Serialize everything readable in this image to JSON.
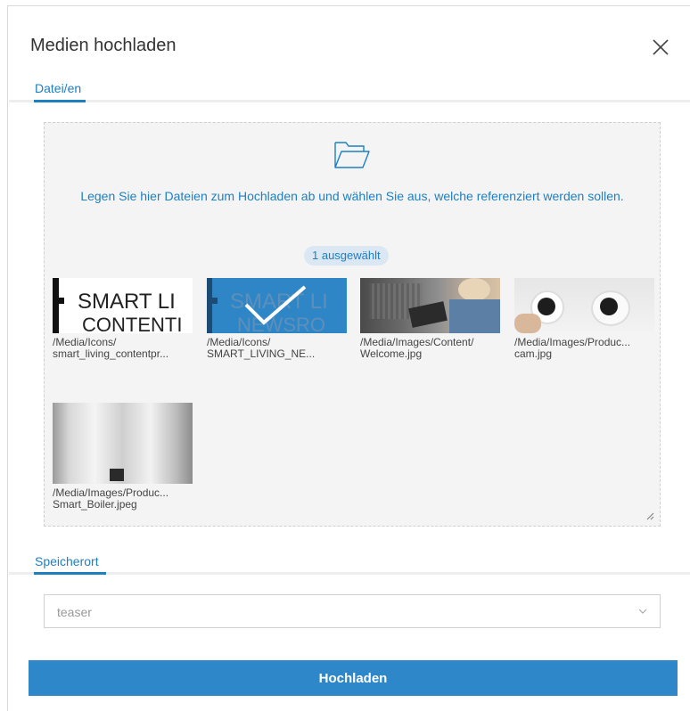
{
  "dialog": {
    "title": "Medien hochladen"
  },
  "tabs": {
    "files_label": "Datei/en",
    "location_label": "Speicherort"
  },
  "dropzone": {
    "hint": "Legen Sie hier Dateien zum Hochladen ab und wählen Sie aus, welche referenziert werden sollen.",
    "selected_badge": "1 ausgewählt",
    "items": [
      {
        "path": "/Media/Icons/",
        "file": "smart_living_contentpr...",
        "selected": false,
        "logo_lines": [
          "SMART LI",
          "CONTENTI"
        ]
      },
      {
        "path": "/Media/Icons/",
        "file": "SMART_LIVING_NE...",
        "selected": true,
        "logo_lines": [
          "SMART LI",
          "NEWSRO"
        ]
      },
      {
        "path": "/Media/Images/Content/",
        "file": "Welcome.jpg",
        "selected": false
      },
      {
        "path": "/Media/Images/Produc...",
        "file": "cam.jpg",
        "selected": false
      },
      {
        "path": "/Media/Images/Produc...",
        "file": "Smart_Boiler.jpeg",
        "selected": false
      }
    ]
  },
  "location": {
    "value": "teaser"
  },
  "actions": {
    "upload_label": "Hochladen"
  },
  "colors": {
    "accent": "#1e7fc1",
    "button": "#2e87c8",
    "selection_overlay": "#2f86c6"
  }
}
